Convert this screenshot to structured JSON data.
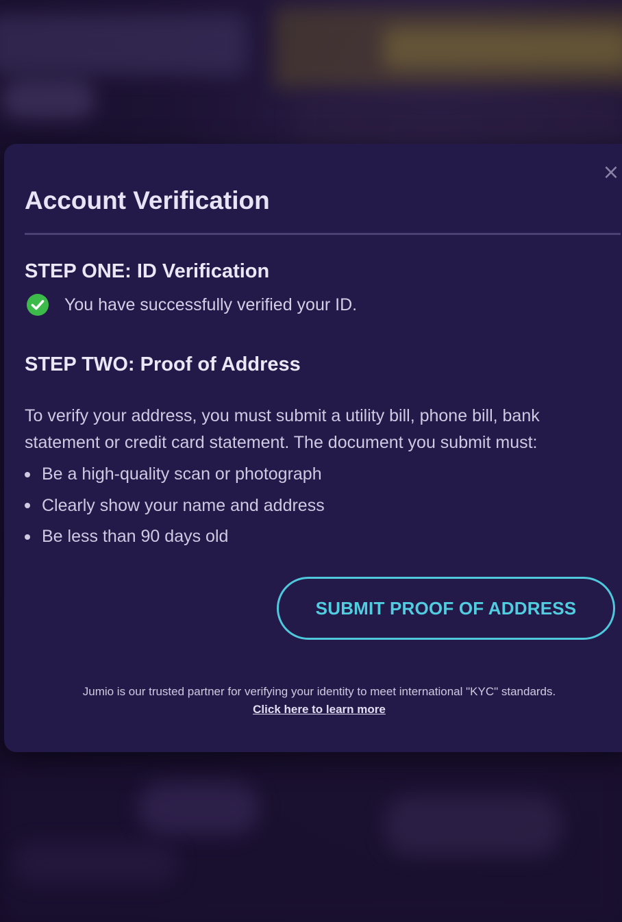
{
  "modal": {
    "title": "Account Verification",
    "close_icon": "close-icon",
    "step_one": {
      "heading": "STEP ONE: ID Verification",
      "status_icon": "check-circle-icon",
      "status_text": "You have successfully verified your ID.",
      "status_color": "#3dbb4a"
    },
    "step_two": {
      "heading": "STEP TWO: Proof of Address",
      "description": "To verify your address, you must submit a utility bill, phone bill, bank statement or credit card statement. The document you submit must:",
      "requirements": [
        "Be a high-quality scan or photograph",
        "Clearly show your name and address",
        "Be less than 90 days old"
      ]
    },
    "submit_button_label": "SUBMIT PROOF OF ADDRESS",
    "accent_color": "#4fc8dc",
    "footer": {
      "note": "Jumio is our trusted partner for verifying your identity to meet international \"KYC\" standards.",
      "link_label": "Click here to learn more"
    }
  }
}
